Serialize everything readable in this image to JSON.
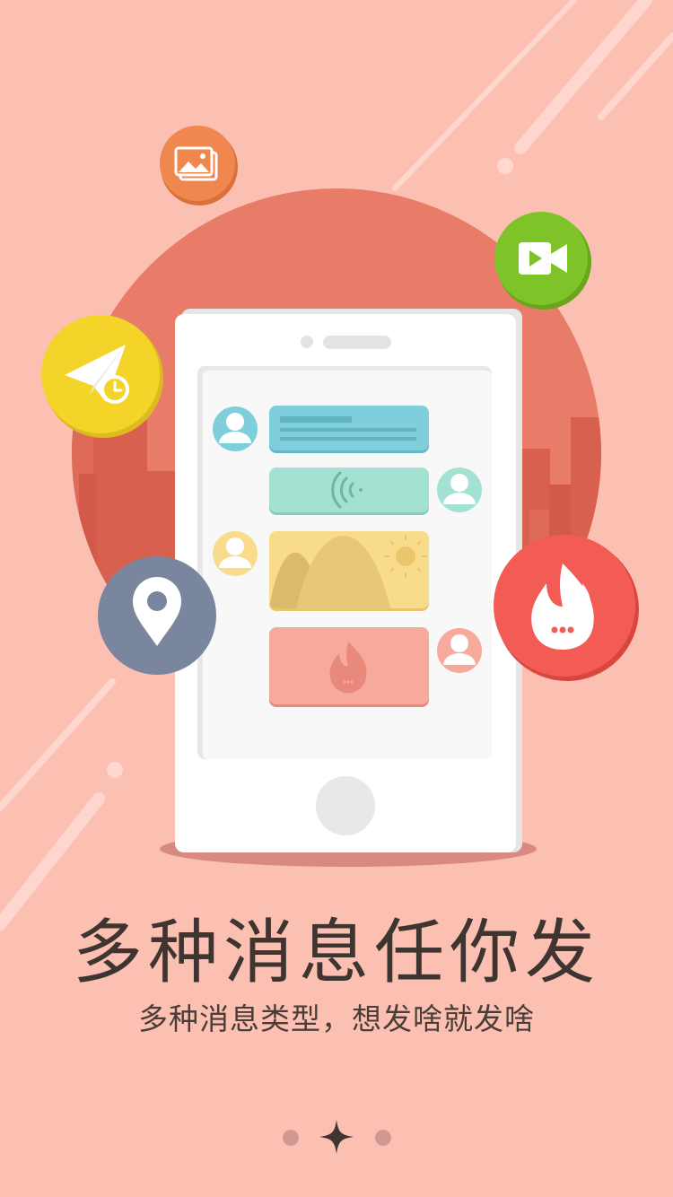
{
  "onboarding": {
    "headline": "多种消息任你发",
    "subline": "多种消息类型，想发啥就发啥",
    "page_indicator": {
      "total": 3,
      "current": 2
    }
  },
  "icons": {
    "image": "image-icon",
    "video": "video-camera-icon",
    "scheduled_send": "paper-plane-clock-icon",
    "location": "location-pin-icon",
    "burn_after_reading": "fire-icon",
    "chat_voice": "voice-wave-icon",
    "chat_picture": "landscape-sun-icon",
    "chat_burn": "fire-icon"
  },
  "colors": {
    "background": "#fcc0b3",
    "sun_circle": "#e97c69",
    "image_badge": "#f0874f",
    "video_badge": "#7ec429",
    "send_badge": "#f5d42a",
    "location_badge": "#7a869e",
    "fire_badge": "#f25c54",
    "text_bubble": "#7ecfdb",
    "voice_bubble": "#a3e2d3",
    "picture_bubble": "#f8dc8c",
    "burn_bubble": "#f7a99c"
  }
}
